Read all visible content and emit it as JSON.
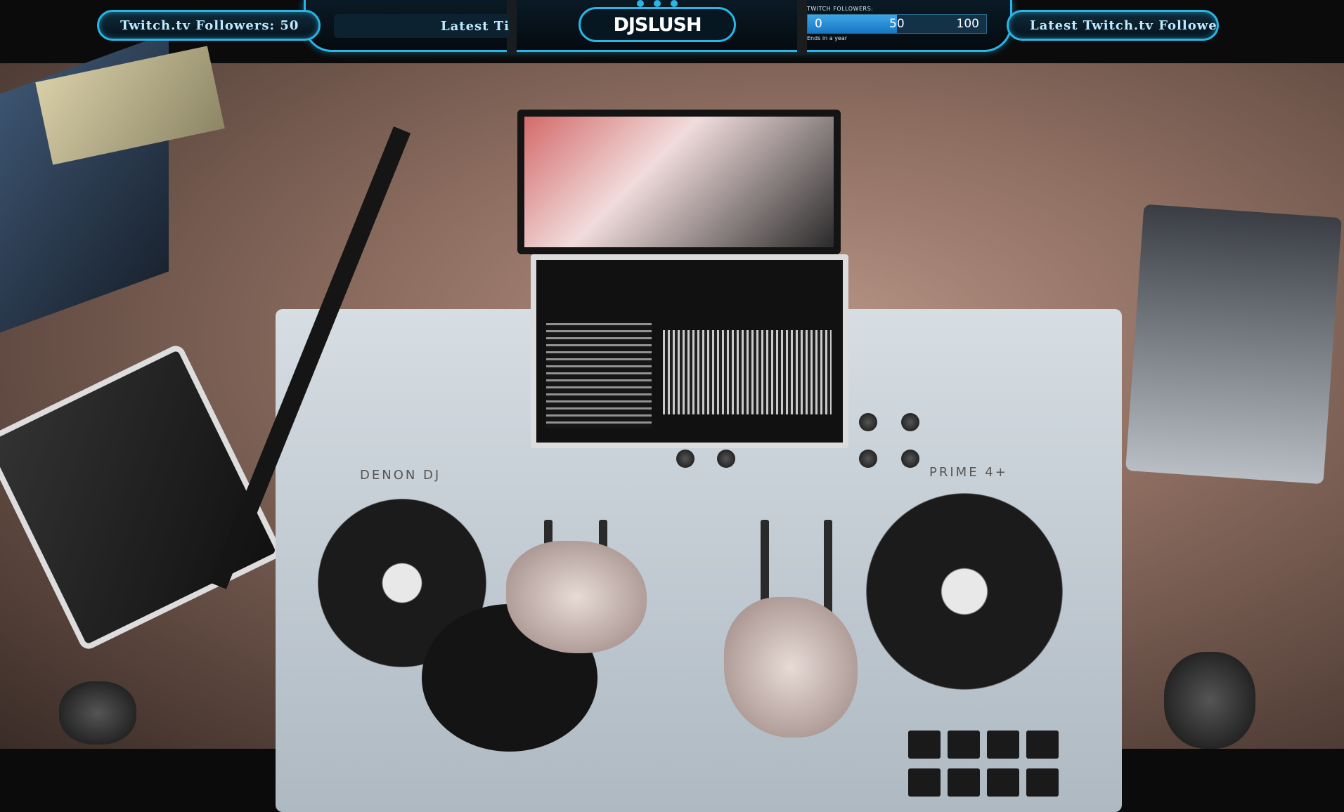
{
  "overlay": {
    "left_pill_text": "Twitch.tv Followers: 50",
    "ticker_text": "Latest Ti",
    "logo": {
      "prefix": "DJ",
      "name": "SLUSH"
    },
    "goal": {
      "title": "TWITCH FOLLOWERS:",
      "min_label": "0",
      "current_label": "50",
      "max_label": "100",
      "progress_fraction": 0.5,
      "note": "Ends in a year"
    },
    "right_pill_text": "Latest Twitch.tv Follower"
  },
  "scene": {
    "left_brand": "DENON DJ",
    "right_brand": "PRIME 4+"
  },
  "colors": {
    "accent": "#27b6e6",
    "goal_fill": "#1877c4"
  }
}
